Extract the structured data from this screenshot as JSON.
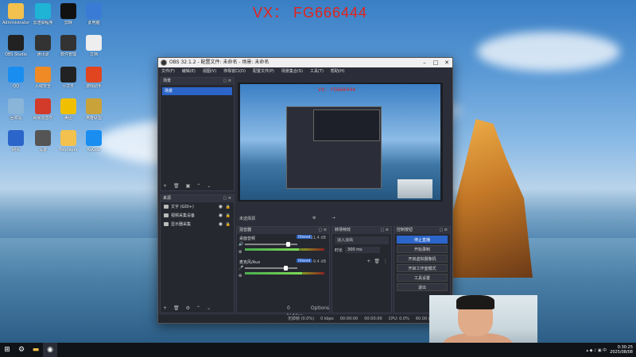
{
  "watermark": "VX： FG666444",
  "desktop_icons": [
    {
      "label": "Administrator",
      "color": "#f2c14e"
    },
    {
      "label": "云渲染程序",
      "color": "#1fb3d6"
    },
    {
      "label": "剪映",
      "color": "#111"
    },
    {
      "label": "此电脑",
      "color": "#3a7bd5"
    },
    {
      "label": "OBS Studio",
      "color": "#222"
    },
    {
      "label": "通讯录",
      "color": "#333"
    },
    {
      "label": "软件管理",
      "color": "#333"
    },
    {
      "label": "文档",
      "color": "#eee"
    },
    {
      "label": "QQ",
      "color": "#1a8ef0"
    },
    {
      "label": "火绒安全",
      "color": "#f08a24"
    },
    {
      "label": "小文件",
      "color": "#222"
    },
    {
      "label": "游戏助手",
      "color": "#e0451f"
    },
    {
      "label": "回收站",
      "color": "#8ab4d8"
    },
    {
      "label": "网易云音乐",
      "color": "#d23a2a"
    },
    {
      "label": "美团",
      "color": "#f0c000"
    },
    {
      "label": "英雄联盟",
      "color": "#c9a23a"
    },
    {
      "label": "网页",
      "color": "#2c65c9"
    },
    {
      "label": "设置",
      "color": "#555"
    },
    {
      "label": "Potplayer",
      "color": "#f2c14e"
    },
    {
      "label": "KuGou",
      "color": "#1a8ef0"
    }
  ],
  "obs": {
    "title": "OBS 32.1.2 - 配置文件: 未命名 - 场景: 未命名",
    "menu": [
      "文件(F)",
      "编辑(E)",
      "视图(V)",
      "停靠窗口(D)",
      "配置文件(P)",
      "场景集合(S)",
      "工具(T)",
      "帮助(H)"
    ],
    "scenes_title": "场景",
    "scene_item": "场景",
    "sources_title": "来源",
    "sources": [
      "文字 (GDI+)",
      "视频采集设备",
      "显示器采集"
    ],
    "preview_toolbar": [
      "未选择源",
      "⚙",
      "→"
    ],
    "mixer_title": "混音器",
    "mixer": [
      {
        "name": "桌面音频",
        "badge": "Filtered",
        "db": "-11.4 dB",
        "level": 0.68,
        "volume": 0.82
      },
      {
        "name": "麦克风/Aux",
        "badge": "Filtered",
        "db": "-9.4 dB",
        "level": 0.72,
        "volume": 0.78
      }
    ],
    "transitions_title": "转场特效",
    "transition_select": "淡入淡出",
    "duration_label": "时长",
    "duration_value": "300 ms",
    "controls_title": "控制按钮",
    "controls": [
      "停止直播",
      "开始录制",
      "开启虚拟摄像机",
      "开启工作室模式",
      "工具设置",
      "退出"
    ],
    "hidden_label": "0 hidden",
    "options_label": "Options",
    "status": [
      "无掉帧 (0.0%)",
      "0 kbps",
      "00:00:00",
      "00:00:00",
      "CPU: 0.0%",
      "60.00 / 60.00 FPS"
    ]
  },
  "taskbar": {
    "time": "0:30:25",
    "date": "2025/08/08"
  }
}
